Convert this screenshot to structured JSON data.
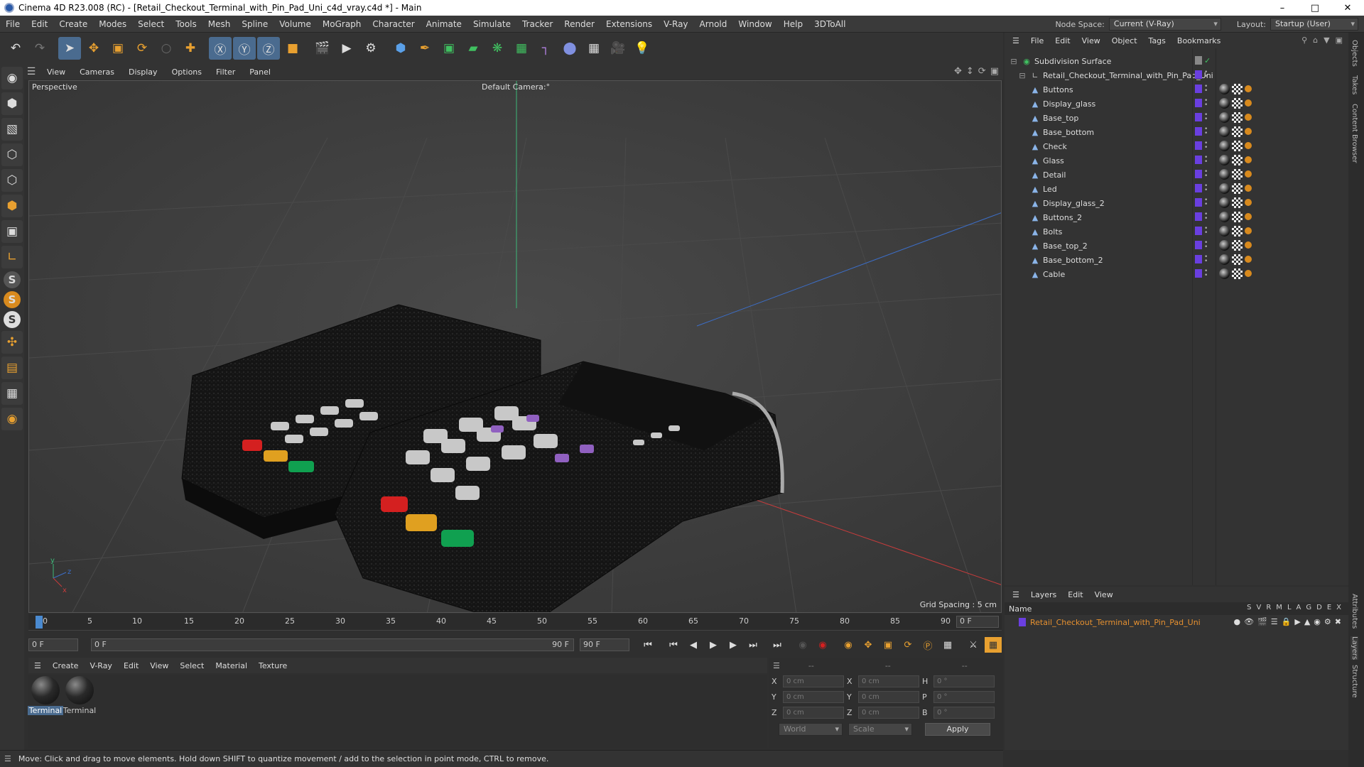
{
  "window": {
    "title": "Cinema 4D R23.008 (RC) - [Retail_Checkout_Terminal_with_Pin_Pad_Uni_c4d_vray.c4d *] - Main",
    "minimize": "–",
    "maximize": "□",
    "close": "✕"
  },
  "menu": [
    "File",
    "Edit",
    "Create",
    "Modes",
    "Select",
    "Tools",
    "Mesh",
    "Spline",
    "Volume",
    "MoGraph",
    "Character",
    "Animate",
    "Simulate",
    "Tracker",
    "Render",
    "Extensions",
    "V-Ray",
    "Arnold",
    "Window",
    "Help",
    "3DToAll"
  ],
  "node_space": {
    "label": "Node Space:",
    "value": "Current (V-Ray)"
  },
  "layout": {
    "label": "Layout:",
    "value": "Startup (User)"
  },
  "toolbar_icons": [
    "undo-icon",
    "redo-icon",
    "select-icon",
    "move-icon",
    "scale-icon",
    "rotate-icon",
    "scale2-icon",
    "transform-icon",
    "x-axis-icon",
    "y-axis-icon",
    "z-axis-icon",
    "coord-icon",
    "render-region-icon",
    "render-view-icon",
    "render-settings-icon",
    "cube-icon",
    "pen-icon",
    "subdiv-icon",
    "extrude-icon",
    "cloner-icon",
    "array-icon",
    "deformer-icon",
    "sphere-field-icon",
    "floor-icon",
    "camera-icon",
    "light-icon"
  ],
  "viewport_menu": [
    "View",
    "Cameras",
    "Display",
    "Options",
    "Filter",
    "Panel"
  ],
  "viewport": {
    "label": "Perspective",
    "camera": "Default Camera",
    "camera_suffix": ":°",
    "grid_spacing": "Grid Spacing : 5 cm"
  },
  "timeline": {
    "ticks": [
      "0",
      "5",
      "10",
      "15",
      "20",
      "25",
      "30",
      "35",
      "40",
      "45",
      "50",
      "55",
      "60",
      "65",
      "70",
      "75",
      "80",
      "85",
      "90"
    ],
    "current_frame": "0 F"
  },
  "playbar": {
    "start": "0 F",
    "range_start": "0 F",
    "range_end": "90 F",
    "end": "90 F"
  },
  "material_menu": [
    "Create",
    "V-Ray",
    "Edit",
    "View",
    "Select",
    "Material",
    "Texture"
  ],
  "materials": [
    {
      "label": "Terminal",
      "selected": true
    },
    {
      "label": "Terminal",
      "selected": false
    }
  ],
  "coords": {
    "header": [
      "--",
      "--",
      "--"
    ],
    "rows": [
      {
        "a1": "X",
        "v1": "0 cm",
        "a2": "X",
        "v2": "0 cm",
        "a3": "H",
        "v3": "0 °"
      },
      {
        "a1": "Y",
        "v1": "0 cm",
        "a2": "Y",
        "v2": "0 cm",
        "a3": "P",
        "v3": "0 °"
      },
      {
        "a1": "Z",
        "v1": "0 cm",
        "a2": "Z",
        "v2": "0 cm",
        "a3": "B",
        "v3": "0 °"
      }
    ],
    "world": "World",
    "scale": "Scale",
    "apply": "Apply"
  },
  "status": "Move: Click and drag to move elements. Hold down SHIFT to quantize movement / add to the selection in point mode, CTRL to remove.",
  "objects_menu": [
    "File",
    "Edit",
    "View",
    "Object",
    "Tags",
    "Bookmarks"
  ],
  "objects": [
    {
      "name": "Subdivision Surface",
      "level": 0,
      "type": "subdiv"
    },
    {
      "name": "Retail_Checkout_Terminal_with_Pin_Pad_Uni",
      "level": 1,
      "type": "null"
    },
    {
      "name": "Buttons",
      "level": 2,
      "type": "poly"
    },
    {
      "name": "Display_glass",
      "level": 2,
      "type": "poly"
    },
    {
      "name": "Base_top",
      "level": 2,
      "type": "poly"
    },
    {
      "name": "Base_bottom",
      "level": 2,
      "type": "poly"
    },
    {
      "name": "Check",
      "level": 2,
      "type": "poly"
    },
    {
      "name": "Glass",
      "level": 2,
      "type": "poly"
    },
    {
      "name": "Detail",
      "level": 2,
      "type": "poly"
    },
    {
      "name": "Led",
      "level": 2,
      "type": "poly"
    },
    {
      "name": "Display_glass_2",
      "level": 2,
      "type": "poly"
    },
    {
      "name": "Buttons_2",
      "level": 2,
      "type": "poly"
    },
    {
      "name": "Bolts",
      "level": 2,
      "type": "poly"
    },
    {
      "name": "Base_top_2",
      "level": 2,
      "type": "poly"
    },
    {
      "name": "Base_bottom_2",
      "level": 2,
      "type": "poly"
    },
    {
      "name": "Cable",
      "level": 2,
      "type": "poly"
    }
  ],
  "layers_menu": [
    "Layers",
    "Edit",
    "View"
  ],
  "layers": {
    "name_header": "Name",
    "columns": [
      "S",
      "V",
      "R",
      "M",
      "L",
      "A",
      "G",
      "D",
      "E",
      "X"
    ],
    "rows": [
      "Retail_Checkout_Terminal_with_Pin_Pad_Uni"
    ]
  },
  "side_tabs": [
    "Objects",
    "Takes",
    "Content Browser",
    "Attributes",
    "Layers",
    "Structure"
  ],
  "colors": {
    "layer_swatch": "#6a3fe0",
    "layer_text": "#e59030",
    "accent": "#4a6b8f",
    "axis_x": "#c83c3c",
    "axis_y": "#3cb878",
    "axis_z": "#3c6ec8"
  }
}
